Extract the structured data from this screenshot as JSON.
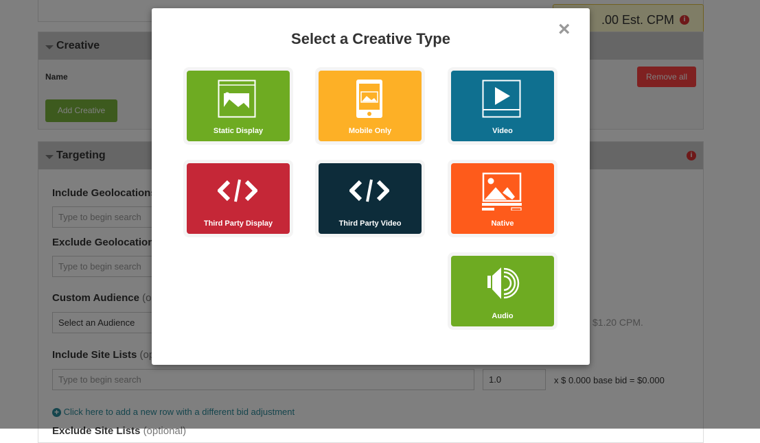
{
  "est_cpm": {
    "text": ".00 Est. CPM",
    "info_icon": "info-icon"
  },
  "creative": {
    "title": "Creative",
    "name_label": "Name",
    "add_button": "Add Creative",
    "remove_all": "Remove all"
  },
  "targeting": {
    "title": "Targeting",
    "include_geo": {
      "label": "Include Geolocations",
      "placeholder": "Type to begin search"
    },
    "exclude_geo": {
      "label": "Exclude Geolocation",
      "placeholder": "Type to begin search"
    },
    "audience": {
      "label": "Custom Audience",
      "optional": "(op",
      "value": "Select an Audience",
      "price_note": "$1.20 CPM."
    },
    "site_lists": {
      "label": "Include Site Lists",
      "optional": "(op",
      "placeholder": "Type to begin search",
      "multiplier": "1.0",
      "bid_formula": "x $ 0.000 base bid = $0.000"
    },
    "add_row_link": "Click here to add a new row with a different bid adjustment",
    "exclude_site_lists": {
      "label": "Exclude Site Lists",
      "optional": "(optional)"
    }
  },
  "modal": {
    "title": "Select a Creative Type",
    "close": "×",
    "types": [
      {
        "label": "Static Display",
        "color": "#6eab22",
        "icon": "static-display-icon"
      },
      {
        "label": "Mobile Only",
        "color": "#fdb026",
        "icon": "mobile-icon"
      },
      {
        "label": "Video",
        "color": "#0f7090",
        "icon": "video-play-icon"
      },
      {
        "label": "Third Party Display",
        "color": "#c52737",
        "icon": "code-icon"
      },
      {
        "label": "Third Party Video",
        "color": "#0d2c3a",
        "icon": "code-icon"
      },
      {
        "label": "Native",
        "color": "#fe5b1b",
        "icon": "native-icon"
      },
      {
        "label": "Audio",
        "color": "#6eab22",
        "icon": "speaker-icon"
      }
    ]
  }
}
